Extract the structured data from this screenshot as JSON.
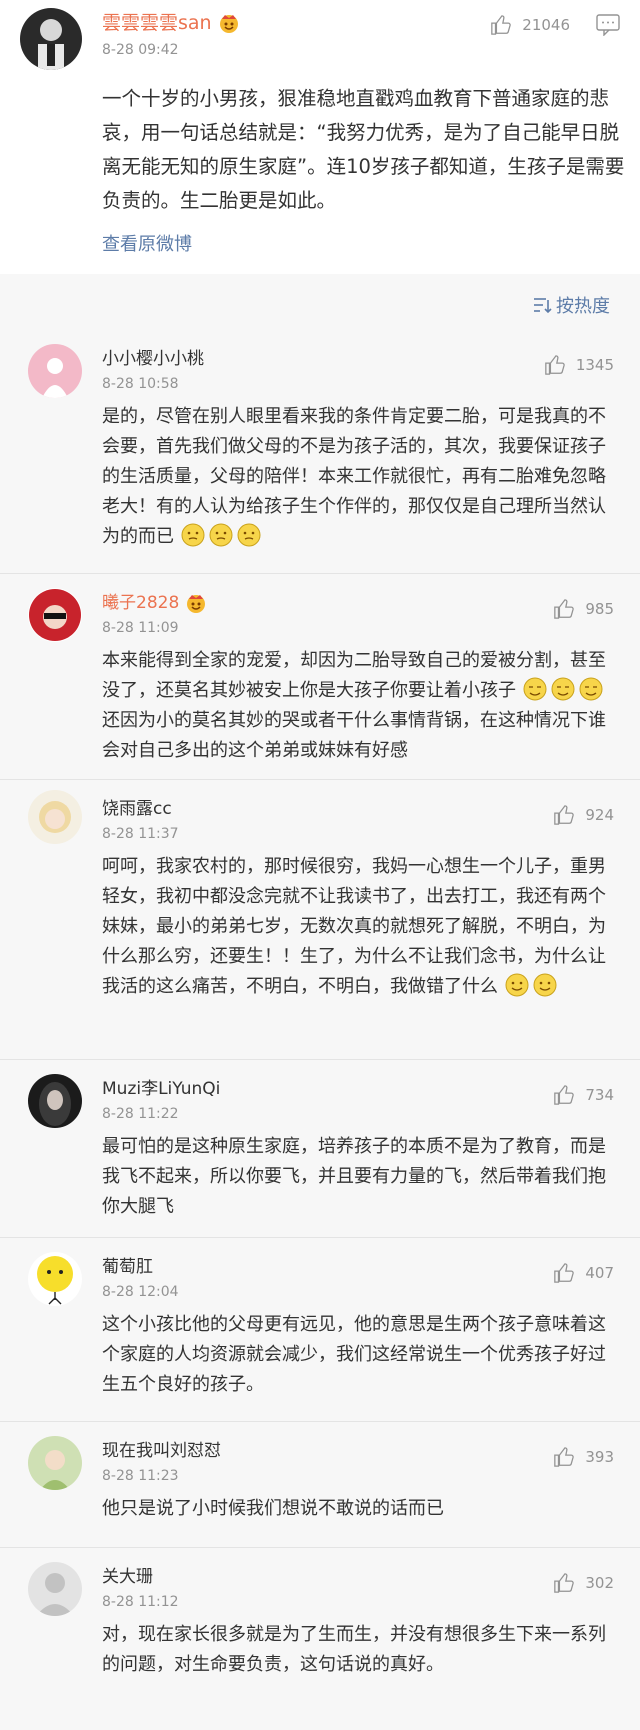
{
  "main_post": {
    "username": "雲雲雲雲san",
    "date": "8-28 09:42",
    "like_count": "21046",
    "text": "一个十岁的小男孩，狠准稳地直戳鸡血教育下普通家庭的悲哀，用一句话总结就是：“我努力优秀，是为了自己能早日脱离无能无知的原生家庭”。连10岁孩子都知道，生孩子是需要负责的。生二胎更是如此。",
    "source_link": "查看原微博"
  },
  "sort": {
    "label": "按热度"
  },
  "comments": [
    {
      "username": "小小樱小小桃",
      "date": "8-28 10:58",
      "likes": "1345",
      "text": "是的，尽管在别人眼里看来我的条件肯定要二胎，可是我真的不会要，首先我们做父母的不是为孩子活的，其次，我要保证孩子的生活质量，父母的陪伴！本来工作就很忙，再有二胎难免忽略老大！有的人认为给孩子生个作伴的，那仅仅是自己理所当然认为的而已"
    },
    {
      "username": "曦子2828",
      "date": "8-28 11:09",
      "likes": "985",
      "text_a": "本来能得到全家的宠爱，却因为二胎导致自己的爱被分割，甚至没了，还莫名其妙被安上你是大孩子你要让着小孩子",
      "text_b": "还因为小的莫名其妙的哭或者干什么事情背锅，在这种情况下谁会对自己多出的这个弟弟或妹妹有好感"
    },
    {
      "username": "饶雨露cc",
      "date": "8-28 11:37",
      "likes": "924",
      "text": "呵呵，我家农村的，那时候很穷，我妈一心想生一个儿子，重男轻女，我初中都没念完就不让我读书了，出去打工，我还有两个妹妹，最小的弟弟七岁，无数次真的就想死了解脱，不明白，为什么那么穷，还要生！！生了，为什么不让我们念书，为什么让我活的这么痛苦，不明白，不明白，我做错了什么"
    },
    {
      "username": "Muzi李LiYunQi",
      "date": "8-28 11:22",
      "likes": "734",
      "text": "最可怕的是这种原生家庭，培养孩子的本质不是为了教育，而是我飞不起来，所以你要飞，并且要有力量的飞，然后带着我们抱你大腿飞"
    },
    {
      "username": "葡萄肛",
      "date": "8-28 12:04",
      "likes": "407",
      "text": "这个小孩比他的父母更有远见，他的意思是生两个孩子意味着这个家庭的人均资源就会减少，我们这经常说生一个优秀孩子好过生五个良好的孩子。"
    },
    {
      "username": "现在我叫刘怼怼",
      "date": "8-28 11:23",
      "likes": "393",
      "text": "他只是说了小时候我们想说不敢说的话而已"
    },
    {
      "username": "关大珊",
      "date": "8-28 11:12",
      "likes": "302",
      "text": "对，现在家长很多就是为了生而生，并没有想很多生下来一系列的问题，对生命要负责，这句话说的真好。"
    }
  ],
  "colors": {
    "name_orange": "#eb7350",
    "link_blue": "#5d7ca8",
    "muted": "#939393"
  },
  "icons": [
    "thumb-up-icon",
    "comment-icon",
    "sort-icon",
    "crown-icon",
    "emoji-icon"
  ]
}
